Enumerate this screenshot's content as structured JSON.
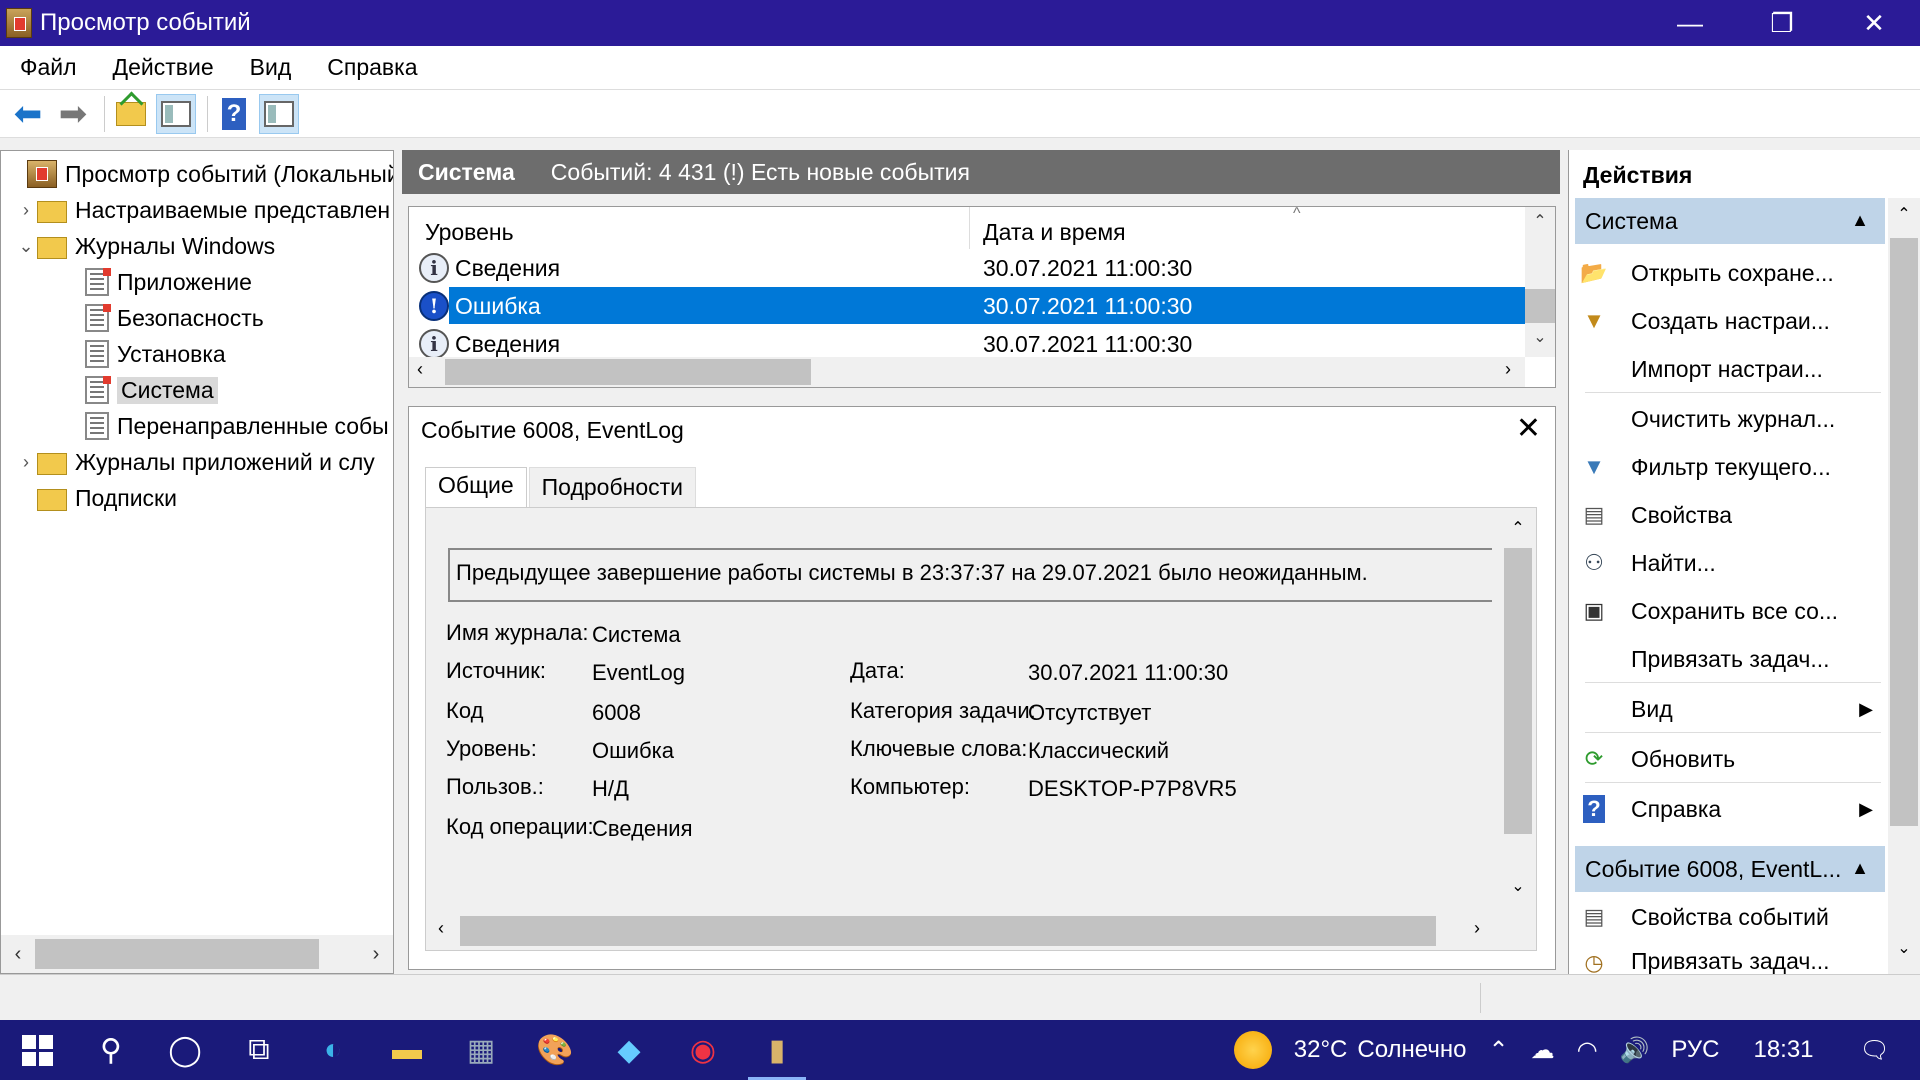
{
  "window": {
    "title": "Просмотр событий",
    "minimize": "—",
    "restore": "❐",
    "close": "✕"
  },
  "menu": [
    "Файл",
    "Действие",
    "Вид",
    "Справка"
  ],
  "tree": {
    "items": [
      {
        "label": "Просмотр событий (Локальный",
        "expander": ""
      },
      {
        "label": "Настраиваемые представлен",
        "expander": "›"
      },
      {
        "label": "Журналы Windows",
        "expander": "⌄"
      },
      {
        "label": "Приложение",
        "expander": ""
      },
      {
        "label": "Безопасность",
        "expander": ""
      },
      {
        "label": "Установка",
        "expander": ""
      },
      {
        "label": "Система",
        "expander": ""
      },
      {
        "label": "Перенаправленные собы",
        "expander": ""
      },
      {
        "label": "Журналы приложений и слу",
        "expander": "›"
      },
      {
        "label": "Подписки",
        "expander": ""
      }
    ]
  },
  "log_header": {
    "name": "Система",
    "info": "Событий: 4 431 (!) Есть новые события"
  },
  "grid": {
    "columns": [
      "Уровень",
      "Дата и время"
    ],
    "rows": [
      {
        "level": "Сведения",
        "datetime": "30.07.2021 11:00:30",
        "icon": "i"
      },
      {
        "level": "Ошибка",
        "datetime": "30.07.2021 11:00:30",
        "icon": "!"
      },
      {
        "level": "Сведения",
        "datetime": "30.07.2021 11:00:30",
        "icon": "i"
      }
    ]
  },
  "detail": {
    "title": "Событие 6008, EventLog",
    "close": "✕",
    "tabs": [
      "Общие",
      "Подробности"
    ],
    "message": "Предыдущее завершение работы системы в 23:37:37 на 29.07.2021 было неожиданным.",
    "fields": {
      "log_name_label": "Имя журнала:",
      "log_name": "Система",
      "source_label": "Источник:",
      "source": "EventLog",
      "date_label": "Дата:",
      "date": "30.07.2021 11:00:30",
      "code_label": "Код",
      "code": "6008",
      "category_label": "Категория задачи:",
      "category": "Отсутствует",
      "level_label": "Уровень:",
      "level": "Ошибка",
      "keywords_label": "Ключевые слова:",
      "keywords": "Классический",
      "user_label": "Пользов.:",
      "user": "Н/Д",
      "computer_label": "Компьютер:",
      "computer": "DESKTOP-P7P8VR5",
      "opcode_label": "Код операции:",
      "opcode": "Сведения"
    }
  },
  "actions": {
    "title": "Действия",
    "section1": "Система",
    "items1": [
      {
        "label": "Открыть сохране...",
        "icon": "folder-open-icon"
      },
      {
        "label": "Создать настраи...",
        "icon": "filter-create-icon"
      },
      {
        "label": "Импорт настраи...",
        "icon": ""
      },
      {
        "label": "Очистить журнал...",
        "icon": ""
      },
      {
        "label": "Фильтр текущего...",
        "icon": "filter-icon"
      },
      {
        "label": "Свойства",
        "icon": "properties-icon"
      },
      {
        "label": "Найти...",
        "icon": "binoculars-icon"
      },
      {
        "label": "Сохранить все со...",
        "icon": "save-icon"
      },
      {
        "label": "Привязать задач...",
        "icon": ""
      },
      {
        "label": "Вид",
        "icon": "",
        "submenu": "▶"
      },
      {
        "label": "Обновить",
        "icon": "refresh-icon"
      },
      {
        "label": "Справка",
        "icon": "help-icon",
        "submenu": "▶"
      }
    ],
    "section2": "Событие 6008, EventL...",
    "items2": [
      {
        "label": "Свойства событий",
        "icon": "properties-icon"
      },
      {
        "label": "Привязать задач...",
        "icon": "task-icon"
      }
    ]
  },
  "taskbar": {
    "weather_temp": "32°C",
    "weather_text": "Солнечно",
    "lang": "РУС",
    "time": "18:31"
  }
}
